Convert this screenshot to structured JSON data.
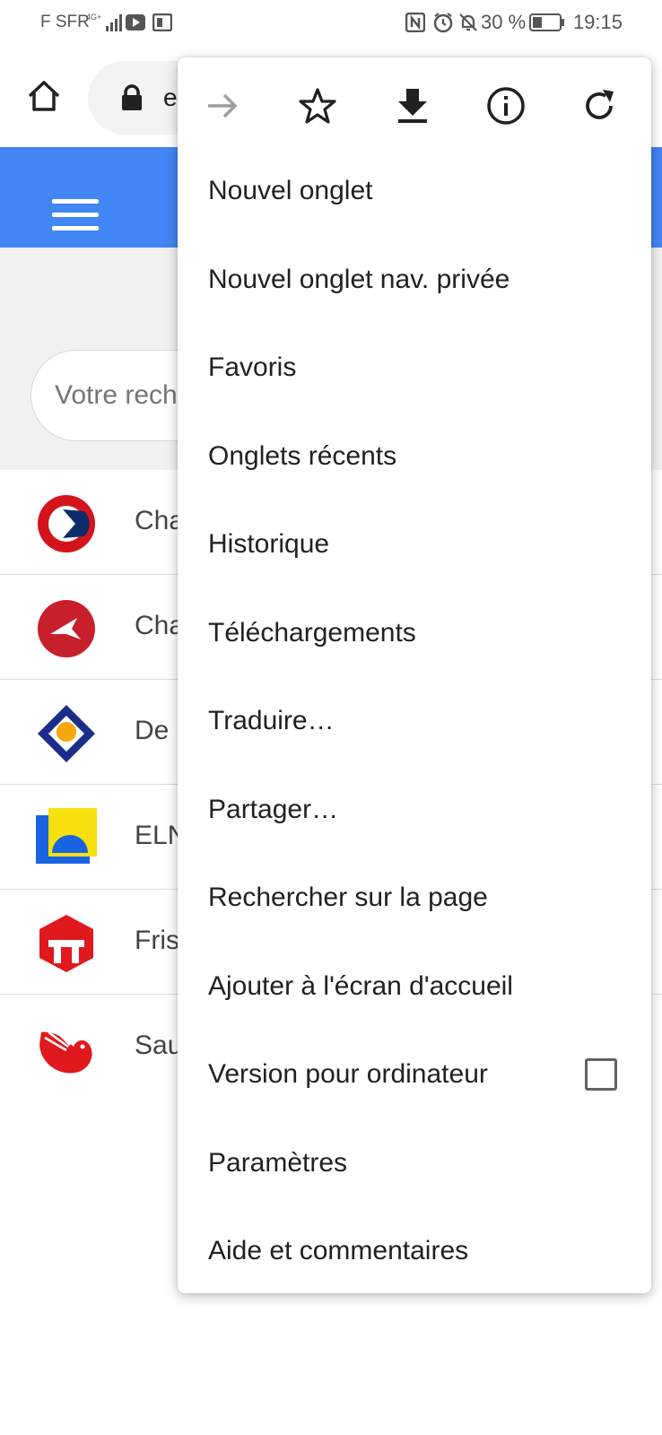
{
  "status_bar": {
    "carrier": "F SFR",
    "battery_percent": "30 %",
    "time": "19:15"
  },
  "toolbar": {
    "url_text": "e",
    "icons": [
      "home-icon",
      "lock-icon"
    ]
  },
  "page": {
    "search_placeholder": "Votre rech",
    "list_items": [
      {
        "label": "Cha",
        "logo": "logo-red-blue-circle"
      },
      {
        "label": "Cha",
        "logo": "logo-red-plane-circle"
      },
      {
        "label": "De",
        "logo": "logo-blue-diamond"
      },
      {
        "label": "ELN",
        "logo": "logo-blue-yellow-square"
      },
      {
        "label": "Fris",
        "logo": "logo-red-hexagon"
      },
      {
        "label": "Sau",
        "logo": "logo-red-bird"
      }
    ]
  },
  "menu": {
    "icon_row": [
      "forward-icon",
      "star-icon",
      "download-icon",
      "info-icon",
      "reload-icon"
    ],
    "items": [
      {
        "label": "Nouvel onglet"
      },
      {
        "label": "Nouvel onglet nav. privée"
      },
      {
        "label": "Favoris"
      },
      {
        "label": "Onglets récents"
      },
      {
        "label": "Historique"
      },
      {
        "label": "Téléchargements"
      },
      {
        "label": "Traduire…"
      },
      {
        "label": "Partager…"
      },
      {
        "label": "Rechercher sur la page"
      },
      {
        "label": "Ajouter à l'écran d'accueil"
      },
      {
        "label": "Version pour ordinateur",
        "checked": false
      },
      {
        "label": "Paramètres"
      },
      {
        "label": "Aide et commentaires"
      }
    ]
  },
  "colors": {
    "header_blue": "#4285f4",
    "menu_text": "#202124",
    "disabled_icon": "#9e9e9e"
  }
}
